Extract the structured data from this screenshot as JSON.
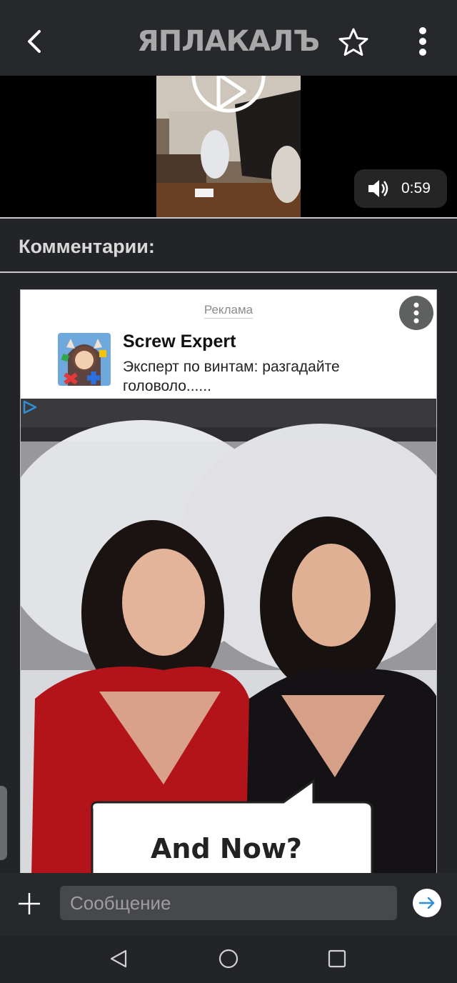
{
  "header": {
    "logo_text": "ЯПЛАКАЛЪ",
    "back_icon": "chevron-left-icon",
    "favorite_icon": "star-outline-icon",
    "menu_icon": "vertical-dots-icon"
  },
  "video": {
    "duration": "0:59",
    "play_icon": "play-icon",
    "volume_icon": "volume-icon"
  },
  "comments": {
    "title": "Комментарии:"
  },
  "ad": {
    "label": "Реклама",
    "app_name": "Screw Expert",
    "description": "Эксперт по винтам: разгадайте головоло......",
    "image_caption": "And Now?",
    "adchoices_icon": "adchoices-icon",
    "more_icon": "more-vertical-icon"
  },
  "compose": {
    "placeholder": "Сообщение",
    "value": "",
    "add_icon": "plus-icon",
    "send_icon": "arrow-right-icon"
  },
  "nav": {
    "back_icon": "triangle-back-icon",
    "home_icon": "circle-home-icon",
    "recents_icon": "square-recents-icon"
  },
  "colors": {
    "background": "#232427",
    "bar": "#27282b",
    "accent_send": "#2f8fd6",
    "ad_shirt_red": "#b3141a"
  }
}
